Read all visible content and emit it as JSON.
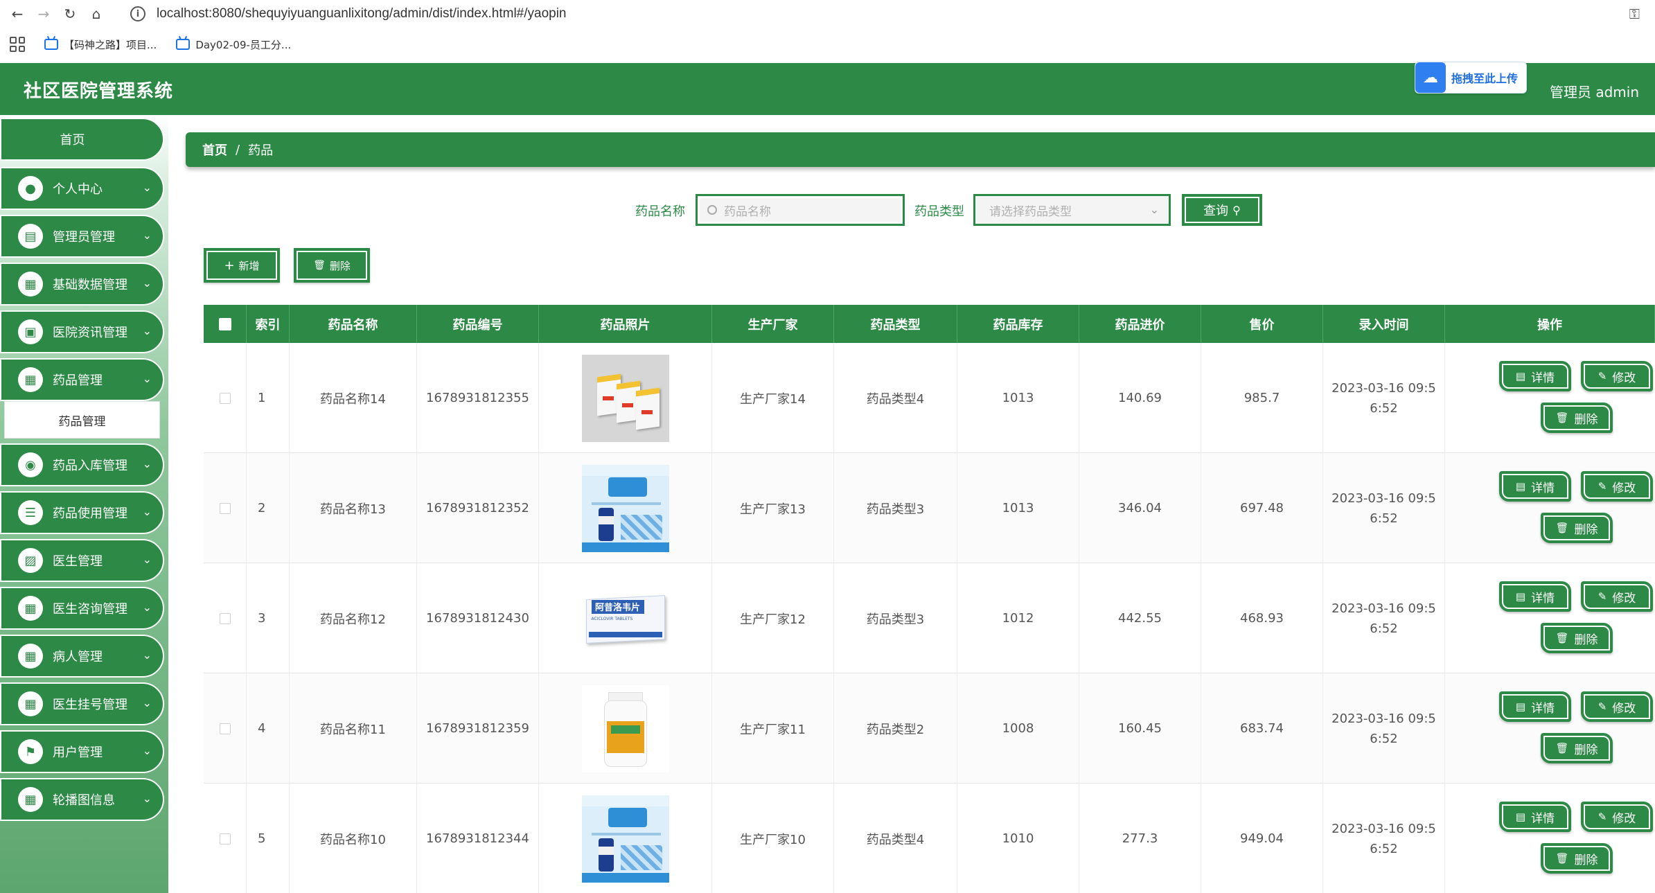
{
  "browser": {
    "url": "localhost:8080/shequyiyuanguanlixitong/admin/dist/index.html#/yaopin",
    "bookmarks": [
      "【码神之路】项目...",
      "Day02-09-员工分..."
    ]
  },
  "header": {
    "title": "社区医院管理系统",
    "upload_label": "拖拽至此上传",
    "admin_label": "管理员 admin"
  },
  "sidebar": {
    "home": "首页",
    "items": [
      {
        "label": "个人中心",
        "icon": "person-icon"
      },
      {
        "label": "管理员管理",
        "icon": "clipboard-icon"
      },
      {
        "label": "基础数据管理",
        "icon": "grid-icon"
      },
      {
        "label": "医院资讯管理",
        "icon": "briefcase-icon"
      },
      {
        "label": "药品管理",
        "icon": "grid-icon"
      },
      {
        "label": "药品入库管理",
        "icon": "location-icon"
      },
      {
        "label": "药品使用管理",
        "icon": "list-icon"
      },
      {
        "label": "医生管理",
        "icon": "wallet-icon"
      },
      {
        "label": "医生咨询管理",
        "icon": "grid-icon"
      },
      {
        "label": "病人管理",
        "icon": "grid-icon"
      },
      {
        "label": "医生挂号管理",
        "icon": "grid-icon"
      },
      {
        "label": "用户管理",
        "icon": "flag-icon"
      },
      {
        "label": "轮播图信息",
        "icon": "grid-icon"
      }
    ],
    "submenu": "药品管理"
  },
  "breadcrumb": {
    "home": "首页",
    "separator": "/",
    "current": "药品"
  },
  "search": {
    "name_label": "药品名称",
    "name_placeholder": "药品名称",
    "type_label": "药品类型",
    "type_placeholder": "请选择药品类型",
    "query_label": "查询"
  },
  "actions": {
    "add_label": "新增",
    "delete_label": "删除"
  },
  "table": {
    "headers": [
      "索引",
      "药品名称",
      "药品编号",
      "药品照片",
      "生产厂家",
      "药品类型",
      "药品库存",
      "药品进价",
      "售价",
      "录入时间",
      "操作"
    ],
    "detail_label": "详情",
    "edit_label": "修改",
    "delete_label": "删除",
    "rows": [
      {
        "index": "1",
        "name": "药品名称14",
        "code": "1678931812355",
        "photo": "medicine-boxes-photo",
        "maker": "生产厂家14",
        "type": "药品类型4",
        "stock": "1013",
        "cost": "140.69",
        "price": "985.7",
        "time1": "2023-03-16 09:5",
        "time2": "6:52"
      },
      {
        "index": "2",
        "name": "药品名称13",
        "code": "1678931812352",
        "photo": "supplement-poster-photo",
        "maker": "生产厂家13",
        "type": "药品类型3",
        "stock": "1013",
        "cost": "346.04",
        "price": "697.48",
        "time1": "2023-03-16 09:5",
        "time2": "6:52"
      },
      {
        "index": "3",
        "name": "药品名称12",
        "code": "1678931812430",
        "photo": "aciclovir-box-photo",
        "maker": "生产厂家12",
        "type": "药品类型3",
        "stock": "1012",
        "cost": "442.55",
        "price": "468.93",
        "time1": "2023-03-16 09:5",
        "time2": "6:52"
      },
      {
        "index": "4",
        "name": "药品名称11",
        "code": "1678931812359",
        "photo": "bottle-photo",
        "maker": "生产厂家11",
        "type": "药品类型2",
        "stock": "1008",
        "cost": "160.45",
        "price": "683.74",
        "time1": "2023-03-16 09:5",
        "time2": "6:52"
      },
      {
        "index": "5",
        "name": "药品名称10",
        "code": "1678931812344",
        "photo": "supplement-poster-photo",
        "maker": "生产厂家10",
        "type": "药品类型4",
        "stock": "1010",
        "cost": "277.3",
        "price": "949.04",
        "time1": "2023-03-16 09:5",
        "time2": "6:52"
      }
    ],
    "thumb_text": {
      "aciclovir_cn": "阿昔洛韦片",
      "aciclovir_en": "ACICLOVIR TABLETS"
    }
  },
  "colors": {
    "primary": "#2c8a46",
    "white": "#ffffff"
  }
}
